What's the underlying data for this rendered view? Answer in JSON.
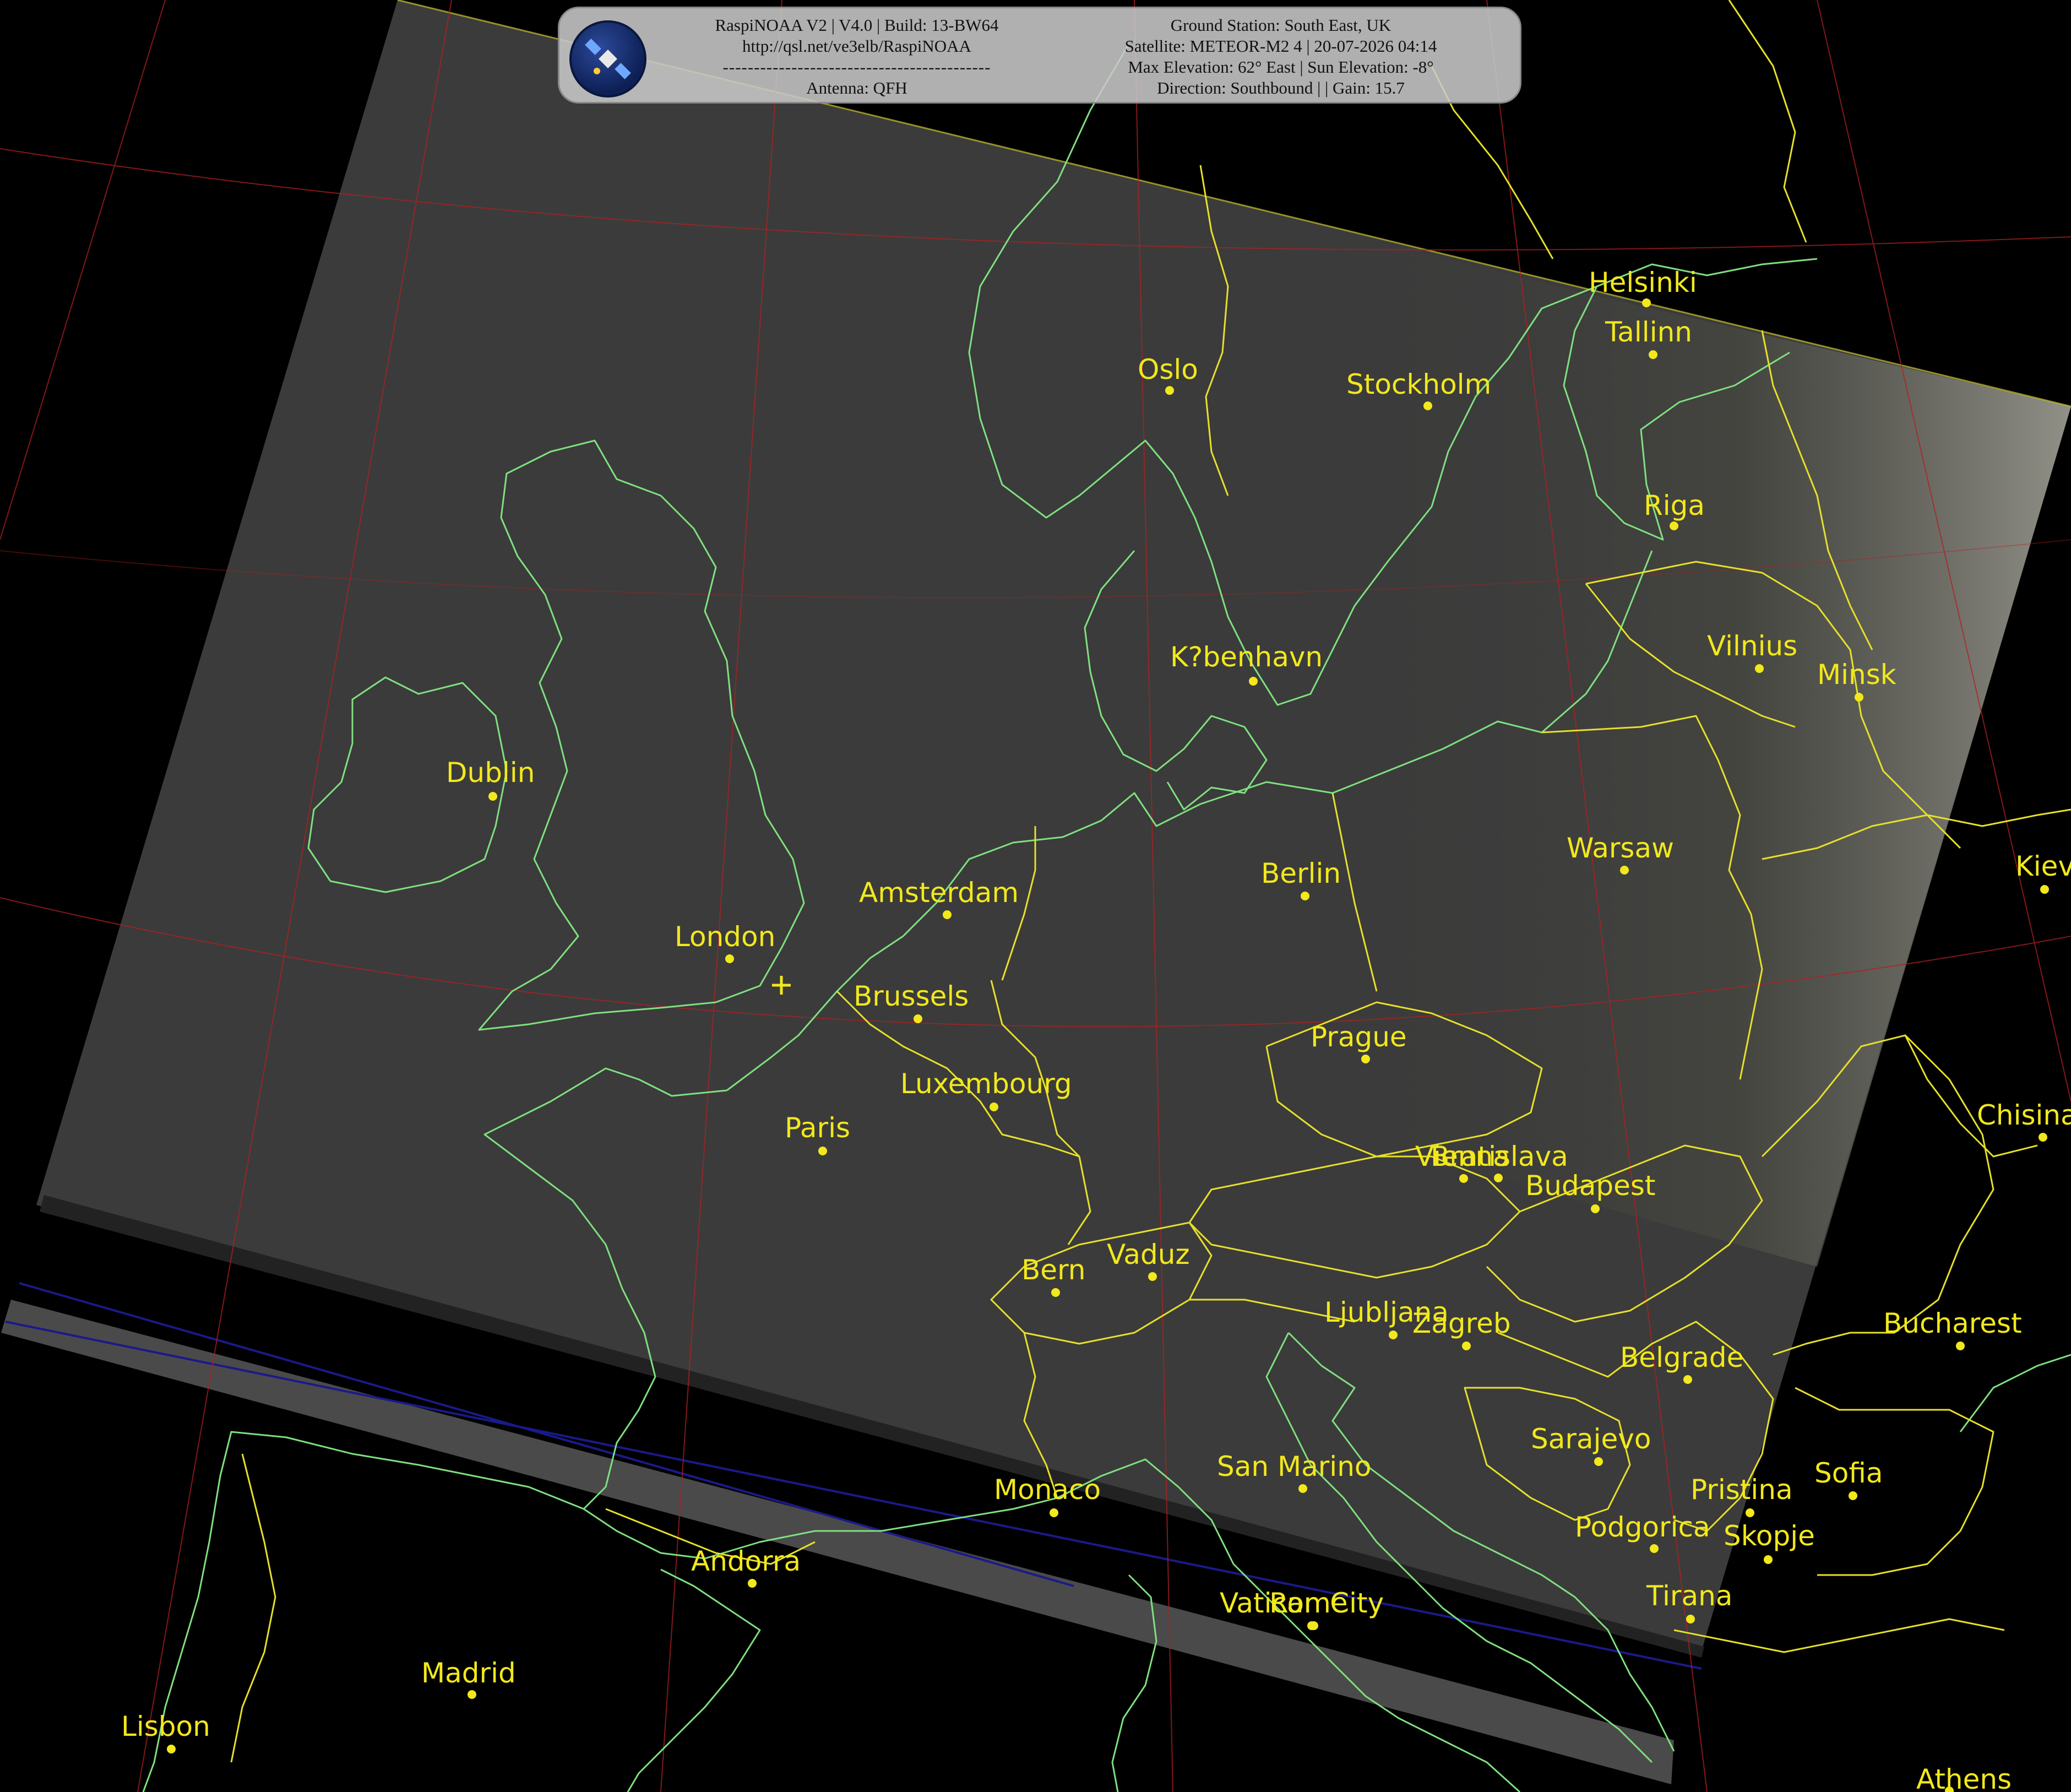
{
  "header": {
    "line1": "RaspiNOAA V2 | V4.0 | Build: 13-BW64",
    "line2": "http://qsl.net/ve3elb/RaspiNOAA",
    "separator": "-------------------------------------------",
    "antenna": "Antenna: QFH",
    "station": "Ground Station: South East, UK",
    "satellite": "Satellite: METEOR-M2 4 | 20-07-2026 04:14",
    "elevation": "Max Elevation: 62° East | Sun Elevation: -8°",
    "direction": "Direction: Southbound | | Gain: 15.7"
  },
  "icons": {
    "logo": "satellite-icon",
    "station_marker": "cross-marker-icon"
  },
  "colors": {
    "coast": "#7fe07f",
    "border": "#e6e02a",
    "label": "#f2e81c",
    "grid": "#b02020",
    "image": "#3a3a3a"
  },
  "cities": [
    {
      "name": "Helsinki"
    },
    {
      "name": "Tallinn"
    },
    {
      "name": "Oslo"
    },
    {
      "name": "Stockholm"
    },
    {
      "name": "Riga"
    },
    {
      "name": "K?benhavn"
    },
    {
      "name": "Vilnius"
    },
    {
      "name": "Minsk"
    },
    {
      "name": "Dublin"
    },
    {
      "name": "Amsterdam"
    },
    {
      "name": "Berlin"
    },
    {
      "name": "Warsaw"
    },
    {
      "name": "Kiev"
    },
    {
      "name": "London"
    },
    {
      "name": "Brussels"
    },
    {
      "name": "Prague"
    },
    {
      "name": "Luxembourg"
    },
    {
      "name": "Paris"
    },
    {
      "name": "Chisinau"
    },
    {
      "name": "Vienna"
    },
    {
      "name": "Bratislava"
    },
    {
      "name": "Budapest"
    },
    {
      "name": "Bern"
    },
    {
      "name": "Vaduz"
    },
    {
      "name": "Ljubljana"
    },
    {
      "name": "Zagreb"
    },
    {
      "name": "Bucharest"
    },
    {
      "name": "Belgrade"
    },
    {
      "name": "Sarajevo"
    },
    {
      "name": "San Marino"
    },
    {
      "name": "Sofia"
    },
    {
      "name": "Monaco"
    },
    {
      "name": "Pristina"
    },
    {
      "name": "Podgorica"
    },
    {
      "name": "Skopje"
    },
    {
      "name": "Andorra"
    },
    {
      "name": "Vatican City"
    },
    {
      "name": "Rome"
    },
    {
      "name": "Tirana"
    },
    {
      "name": "Madrid"
    },
    {
      "name": "Lisbon"
    },
    {
      "name": "Athens"
    }
  ]
}
